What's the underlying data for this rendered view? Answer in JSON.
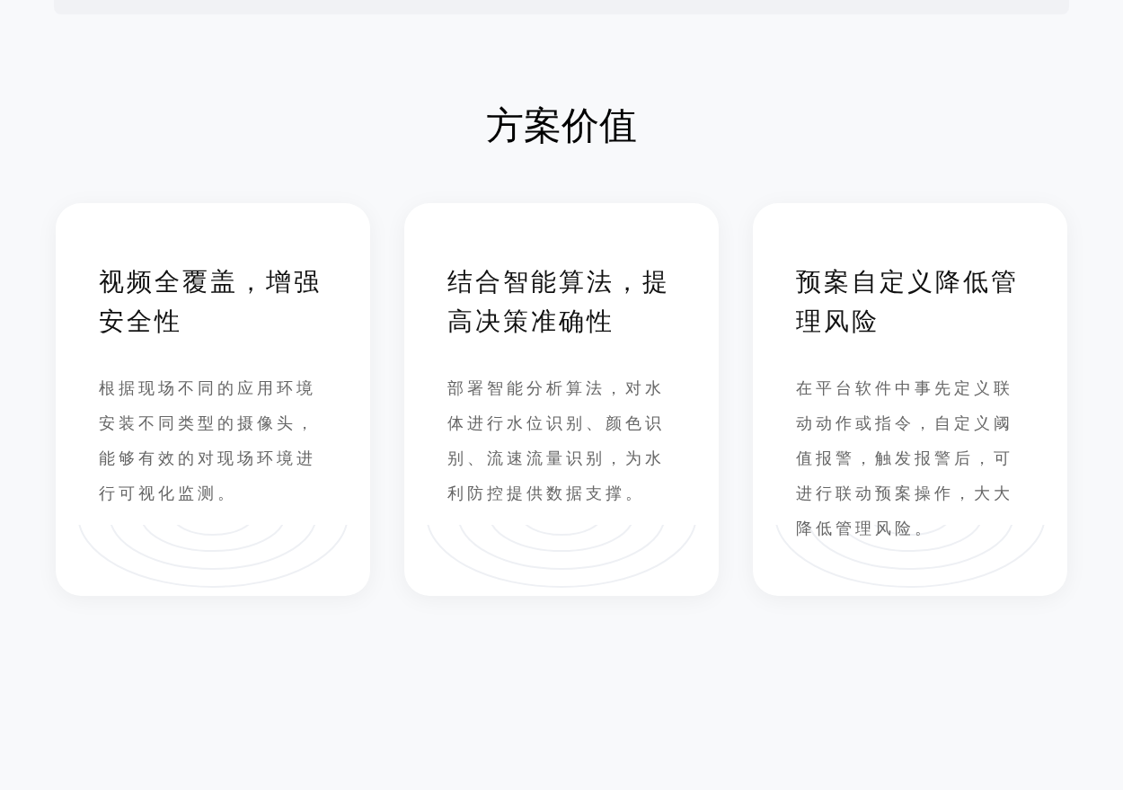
{
  "section": {
    "title": "方案价值"
  },
  "cards": [
    {
      "title": "视频全覆盖，增强安全性",
      "description": "根据现场不同的应用环境安装不同类型的摄像头，能够有效的对现场环境进行可视化监测。"
    },
    {
      "title": "结合智能算法，提高决策准确性",
      "description": "部署智能分析算法，对水体进行水位识别、颜色识别、流速流量识别，为水利防控提供数据支撑。"
    },
    {
      "title": "预案自定义降低管理风险",
      "description": "在平台软件中事先定义联动动作或指令，自定义阈值报警，触发报警后，可进行联动预案操作，大大降低管理风险。"
    }
  ]
}
